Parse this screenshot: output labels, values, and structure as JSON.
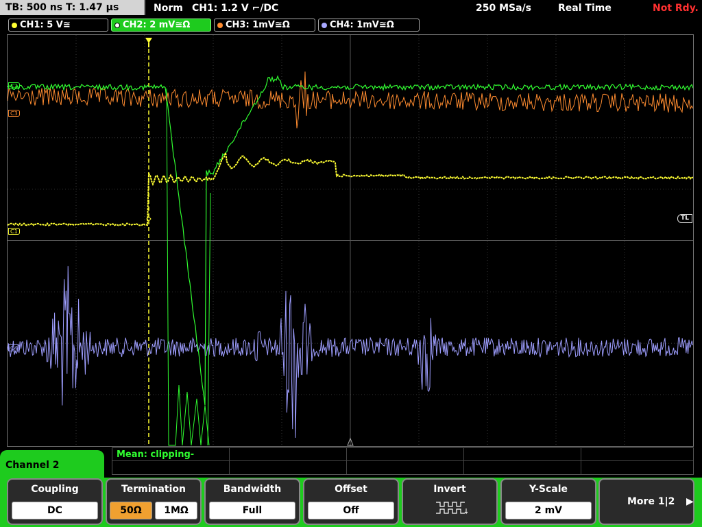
{
  "header": {
    "tb": "TB: 500 ns   T: 1.47 µs",
    "mode": "Norm",
    "trigger": "CH1: 1.2 V ⌐/DC",
    "sample_rate": "250 MSa/s",
    "acq": "Real Time",
    "status": "Not Rdy."
  },
  "channels": [
    {
      "label": "CH1: 5 V≅",
      "color": "#ffff33"
    },
    {
      "label": "CH2: 2 mV≅Ω",
      "color": "#30ff30"
    },
    {
      "label": "CH3: 1mV≅Ω",
      "color": "#ff8c30"
    },
    {
      "label": "CH4: 1mV≅Ω",
      "color": "#a8a8ff"
    }
  ],
  "markers": {
    "c2": "C2",
    "c3": "C3",
    "c1": "C1",
    "c4": "C4",
    "tl": "TL"
  },
  "info": {
    "mean": "Mean: clipping-"
  },
  "menu": {
    "title": "Channel 2",
    "coupling": {
      "label": "Coupling",
      "value": "DC"
    },
    "termination": {
      "label": "Termination",
      "value1": "50Ω",
      "value2": "1MΩ"
    },
    "bandwidth": {
      "label": "Bandwidth",
      "value": "Full"
    },
    "offset": {
      "label": "Offset",
      "value": "Off"
    },
    "invert": {
      "label": "Invert"
    },
    "yscale": {
      "label": "Y-Scale",
      "value": "2 mV"
    },
    "more": {
      "label": "More 1|2"
    }
  }
}
